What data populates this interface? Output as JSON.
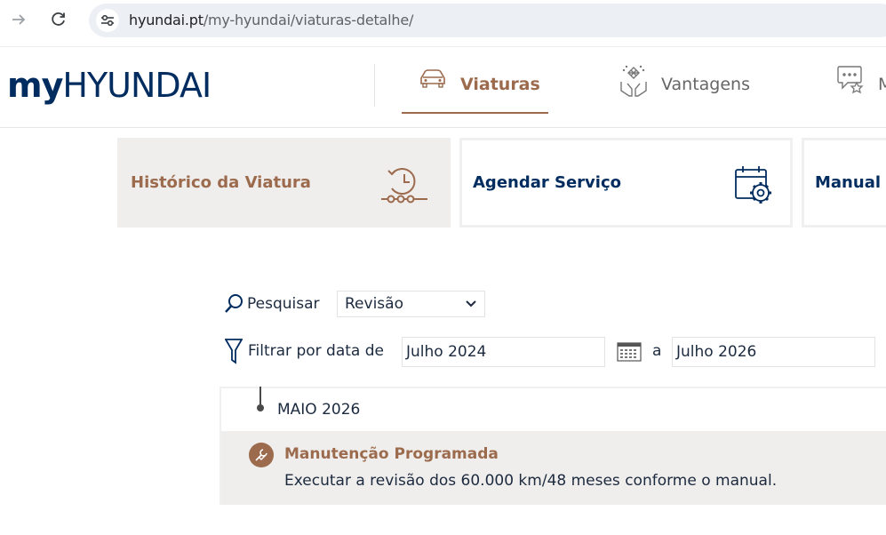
{
  "browser": {
    "url_domain": "hyundai.pt",
    "url_path": "/my-hyundai/viaturas-detalhe/"
  },
  "header": {
    "logo_my": "my",
    "logo_brand": "HYUNDAI",
    "tabs": [
      {
        "label": "Viaturas",
        "icon": "car-icon",
        "active": true
      },
      {
        "label": "Vantagens",
        "icon": "hands-gift-icon",
        "active": false
      },
      {
        "label": "M",
        "icon": "chat-star-icon",
        "active": false
      }
    ]
  },
  "cards": [
    {
      "label": "Histórico da Viatura",
      "icon": "history-clock-icon",
      "active": true
    },
    {
      "label": "Agendar Serviço",
      "icon": "calendar-gear-icon",
      "active": false
    },
    {
      "label": "Manual d",
      "icon": "",
      "active": false
    }
  ],
  "filters": {
    "search_label": "Pesquisar",
    "search_value": "Revisão",
    "date_label": "Filtrar por data de",
    "date_from": "Julho 2024",
    "date_sep": "a",
    "date_to": "Julho 2026"
  },
  "timeline": {
    "month": "MAIO 2026",
    "entries": [
      {
        "title": "Manutenção Programada",
        "description": "Executar a revisão dos 60.000 km/48 meses conforme o manual."
      }
    ]
  },
  "colors": {
    "brand_navy": "#002c5f",
    "accent_bronze": "#9c6b4e",
    "active_bg": "#f0eeec"
  }
}
